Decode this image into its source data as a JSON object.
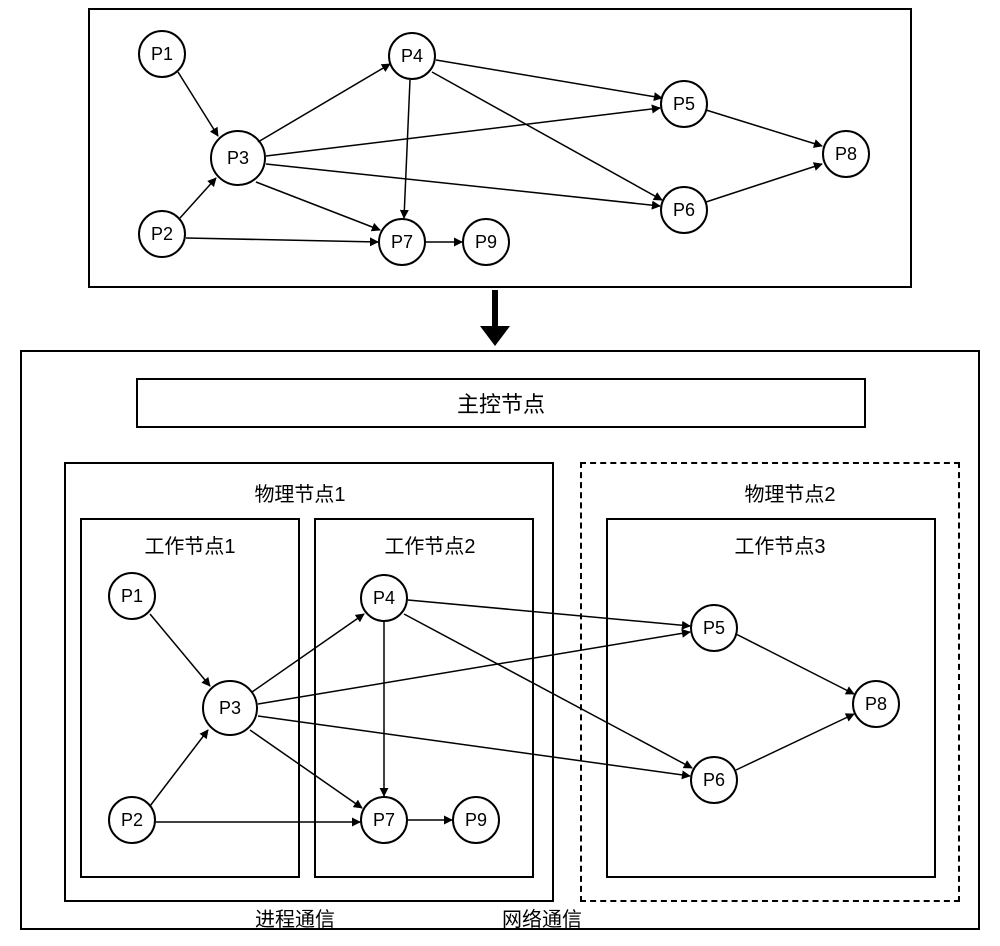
{
  "nodes": {
    "P1": "P1",
    "P2": "P2",
    "P3": "P3",
    "P4": "P4",
    "P5": "P5",
    "P6": "P6",
    "P7": "P7",
    "P8": "P8",
    "P9": "P9"
  },
  "labels": {
    "master": "主控节点",
    "phys1": "物理节点1",
    "phys2": "物理节点2",
    "work1": "工作节点1",
    "work2": "工作节点2",
    "work3": "工作节点3",
    "proc_comm": "进程通信",
    "net_comm": "网络通信"
  },
  "chart_data": {
    "type": "diagram",
    "title": "",
    "description": "Directed dependency graph of processes P1–P9, shown once abstractly (top) and once partitioned onto physical/worker nodes under a master controller (bottom).",
    "graph": {
      "nodes": [
        "P1",
        "P2",
        "P3",
        "P4",
        "P5",
        "P6",
        "P7",
        "P8",
        "P9"
      ],
      "edges": [
        [
          "P1",
          "P3"
        ],
        [
          "P2",
          "P3"
        ],
        [
          "P2",
          "P7"
        ],
        [
          "P3",
          "P4"
        ],
        [
          "P3",
          "P5"
        ],
        [
          "P3",
          "P6"
        ],
        [
          "P3",
          "P7"
        ],
        [
          "P4",
          "P5"
        ],
        [
          "P4",
          "P6"
        ],
        [
          "P4",
          "P7"
        ],
        [
          "P5",
          "P8"
        ],
        [
          "P6",
          "P8"
        ],
        [
          "P7",
          "P9"
        ]
      ]
    },
    "partition": {
      "master": "主控节点",
      "physical_nodes": [
        {
          "name": "物理节点1",
          "workers": [
            {
              "name": "工作节点1",
              "processes": [
                "P1",
                "P2",
                "P3"
              ]
            },
            {
              "name": "工作节点2",
              "processes": [
                "P4",
                "P7",
                "P9"
              ]
            }
          ]
        },
        {
          "name": "物理节点2",
          "workers": [
            {
              "name": "工作节点3",
              "processes": [
                "P5",
                "P6",
                "P8"
              ]
            }
          ]
        }
      ],
      "communication_labels": {
        "between_workers_same_physical": "进程通信",
        "between_physical_nodes": "网络通信"
      }
    }
  }
}
